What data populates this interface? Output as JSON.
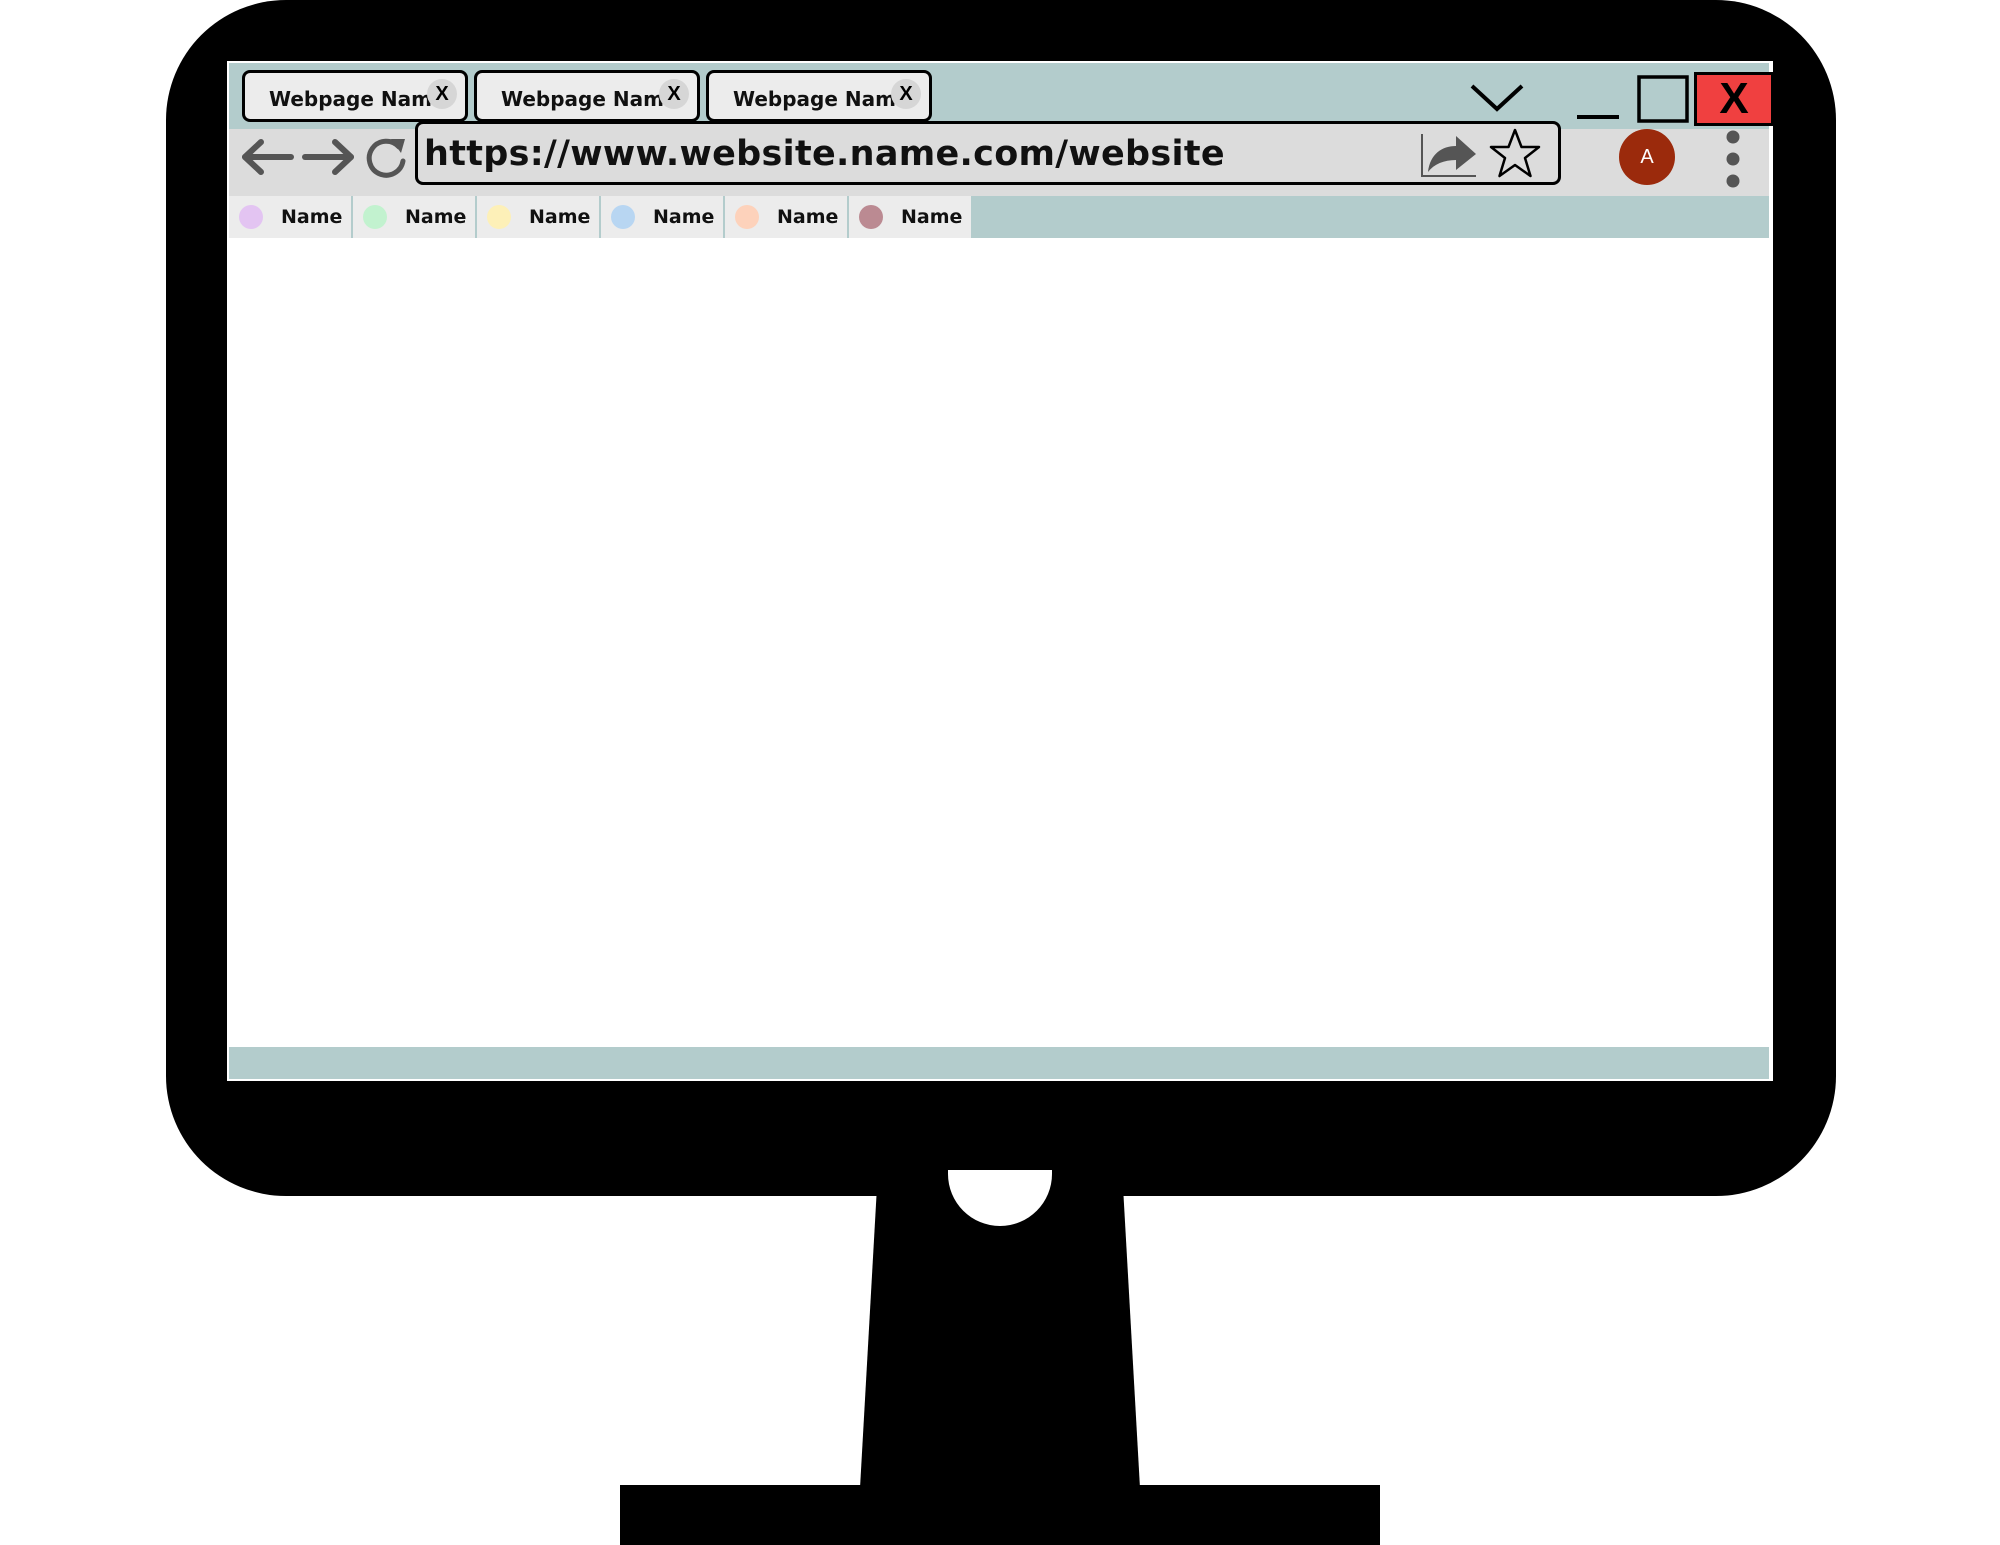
{
  "tabs": [
    {
      "label": "Webpage Name",
      "close_label": "X"
    },
    {
      "label": "Webpage Name",
      "close_label": "X"
    },
    {
      "label": "Webpage Name",
      "close_label": "X"
    }
  ],
  "window_controls": {
    "close_label": "X",
    "close_color": "#f04040"
  },
  "address_bar": {
    "url": "https://www.website.name.com/website"
  },
  "profile": {
    "initial": "A",
    "color": "#9b2a0c"
  },
  "bookmarks": [
    {
      "label": "Name",
      "color": "#e3c4f2"
    },
    {
      "label": "Name",
      "color": "#c2f2cf"
    },
    {
      "label": "Name",
      "color": "#fdf0b8"
    },
    {
      "label": "Name",
      "color": "#b8d6f2"
    },
    {
      "label": "Name",
      "color": "#fdd2bb"
    },
    {
      "label": "Name",
      "color": "#bb8a92"
    }
  ],
  "icons": [
    "chevron-down-icon",
    "minimize-icon",
    "maximize-icon",
    "back-arrow-icon",
    "forward-arrow-icon",
    "reload-icon",
    "share-icon",
    "star-icon",
    "more-vertical-icon"
  ],
  "colors": {
    "chrome_accent": "#b3cccc",
    "toolbar": "#dcdcdc",
    "monitor": "#000000"
  }
}
